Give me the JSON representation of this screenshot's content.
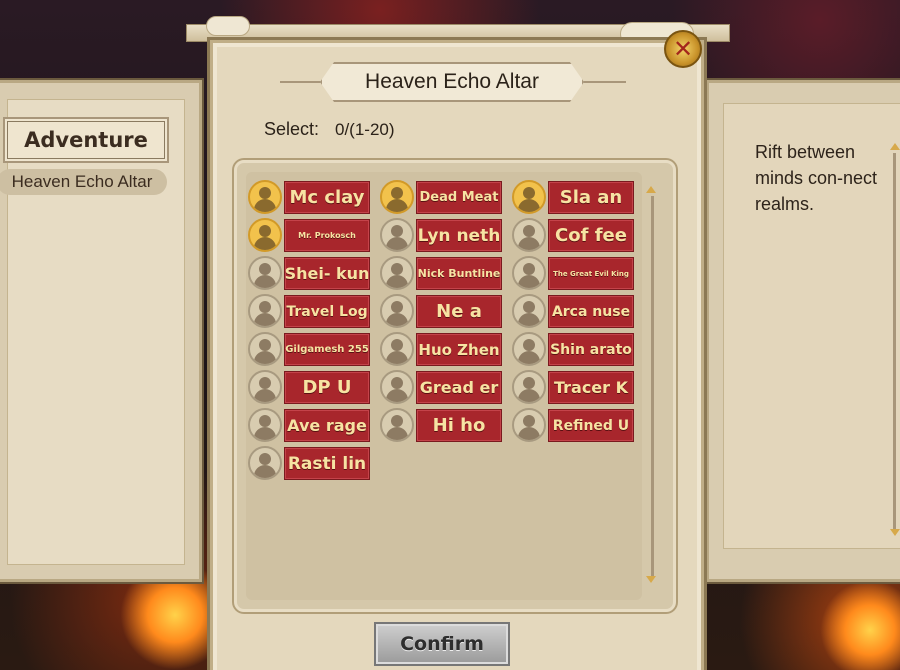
{
  "window": {
    "title": "Heaven Echo Altar"
  },
  "left_panel": {
    "title": "Adventure",
    "selected_item": "Heaven Echo Altar"
  },
  "selection": {
    "label": "Select:",
    "value": "0/(1-20)"
  },
  "members": [
    {
      "name": "Mc clay",
      "avatar": "gold",
      "size": 18
    },
    {
      "name": "Dead Meat",
      "avatar": "gold",
      "size": 13
    },
    {
      "name": "Sla an",
      "avatar": "gold",
      "size": 18
    },
    {
      "name": "Mr. Prokosch",
      "avatar": "gold",
      "size": 8
    },
    {
      "name": "Lyn neth",
      "avatar": "plain",
      "size": 17
    },
    {
      "name": "Cof fee",
      "avatar": "plain",
      "size": 18
    },
    {
      "name": "Shei- kun",
      "avatar": "plain",
      "size": 16
    },
    {
      "name": "Nick Buntline",
      "avatar": "plain",
      "size": 11
    },
    {
      "name": "The Great Evil King",
      "avatar": "plain",
      "size": 7
    },
    {
      "name": "Travel Log",
      "avatar": "plain",
      "size": 14
    },
    {
      "name": "Ne a",
      "avatar": "plain",
      "size": 18
    },
    {
      "name": "Arca nuse",
      "avatar": "plain",
      "size": 14
    },
    {
      "name": "Gilgamesh 255",
      "avatar": "plain",
      "size": 10
    },
    {
      "name": "Huo Zhen",
      "avatar": "plain",
      "size": 15
    },
    {
      "name": "Shin arato",
      "avatar": "plain",
      "size": 14
    },
    {
      "name": "DP U",
      "avatar": "plain",
      "size": 18
    },
    {
      "name": "Gread er",
      "avatar": "plain",
      "size": 16
    },
    {
      "name": "Tracer K",
      "avatar": "plain",
      "size": 16
    },
    {
      "name": "Ave rage",
      "avatar": "plain",
      "size": 16
    },
    {
      "name": "Hi ho",
      "avatar": "plain",
      "size": 18
    },
    {
      "name": "Refined U",
      "avatar": "plain",
      "size": 14
    },
    {
      "name": "Rasti lin",
      "avatar": "plain",
      "size": 17
    }
  ],
  "right_panel": {
    "description": "Rift between minds con-nect realms."
  },
  "confirm_button": {
    "label": "Confirm"
  },
  "icons": {
    "close": "close-icon",
    "avatar": "avatar-icon",
    "scroll_up": "scroll-up-icon",
    "scroll_down": "scroll-down-icon"
  },
  "colors": {
    "name_plate": "#a8262c",
    "name_text": "#f7e3a3",
    "gold_avatar": "#f2c24c",
    "confirm_disabled": "#9a9a9a"
  }
}
